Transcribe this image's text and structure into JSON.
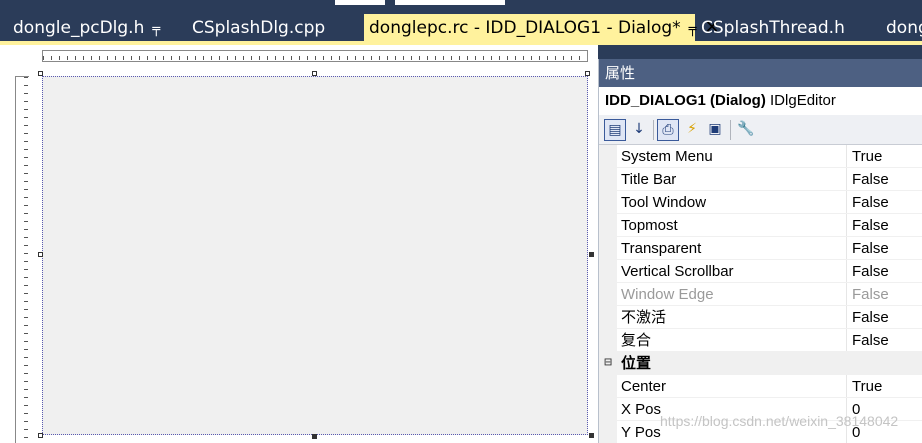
{
  "tabs": [
    {
      "label": "dongle_pcDlg.h",
      "pin": "╤",
      "active": false
    },
    {
      "label": "CSplashDlg.cpp",
      "active": false
    },
    {
      "label": "donglepc.rc - IDD_DIALOG1 - Dialog*",
      "pin": "╤",
      "close": "✕",
      "active": true
    },
    {
      "label": "CSplashThread.h",
      "active": false
    },
    {
      "label": "dong",
      "active": false
    }
  ],
  "properties": {
    "title": "属性",
    "object_name": "IDD_DIALOG1 (Dialog)",
    "object_type": "IDlgEditor",
    "toolbar": [
      "categorized-icon",
      "alphabetical-icon",
      "properties-icon",
      "events-icon",
      "messages-icon",
      "property-pages-icon"
    ],
    "rows": [
      {
        "name": "System Menu",
        "value": "True"
      },
      {
        "name": "Title Bar",
        "value": "False"
      },
      {
        "name": "Tool Window",
        "value": "False"
      },
      {
        "name": "Topmost",
        "value": "False"
      },
      {
        "name": "Transparent",
        "value": "False"
      },
      {
        "name": "Vertical Scrollbar",
        "value": "False"
      },
      {
        "name": "Window Edge",
        "value": "False",
        "disabled": true
      },
      {
        "name": "不激活",
        "value": "False"
      },
      {
        "name": "复合",
        "value": "False"
      }
    ],
    "category": {
      "expander": "⊟",
      "name": "位置"
    },
    "position_rows": [
      {
        "name": "Center",
        "value": "True"
      },
      {
        "name": "X Pos",
        "value": "0"
      },
      {
        "name": "Y Pos",
        "value": "0"
      }
    ]
  },
  "watermark": "https://blog.csdn.net/weixin_38148042"
}
